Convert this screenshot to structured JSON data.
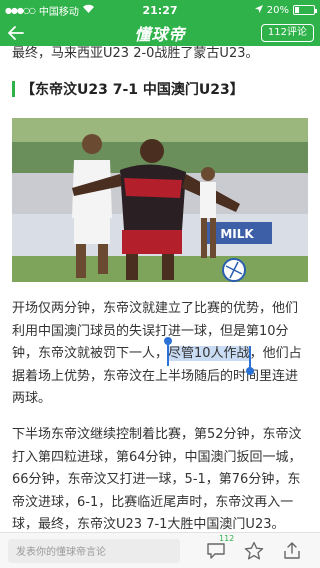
{
  "status_bar": {
    "carrier": "中国移动",
    "time": "21:27",
    "battery_percent": "20%",
    "battery_level": 0.2
  },
  "nav": {
    "title": "懂球帝",
    "comments_button": "112评论"
  },
  "article": {
    "partial_top_line": "最终，马来西亚U23 2-0战胜了蒙古U23。",
    "heading": "【东帝汶U23 7-1 中国澳门U23】",
    "para1_before": "开场仅两分钟，东帝汶就建立了比赛的优势，他们利用中国澳门球员的失误打进一球，但是第10分钟，东帝汶就被罚下一人，",
    "para1_highlight": "尽管10人作战",
    "para1_after": "，他们占据着场上优势，东帝汶在上半场随后的时间里连进两球。",
    "para2": "下半场东帝汶继续控制着比赛，第52分钟，东帝汶打入第四粒进球，第64分钟，中国澳门扳回一城，66分钟，东帝汶又打进一球，5-1，第76分钟，东帝汶进球，6-1，比赛临近尾声时，东帝汶再入一球，最终，东帝汶U23 7-1大胜中国澳门U23。",
    "photo_ad_text": "MILK"
  },
  "bottom_bar": {
    "comment_placeholder": "发表你的懂球帝言论",
    "comment_badge": "112"
  },
  "colors": {
    "brand_green": "#2fb24a",
    "selection_blue": "#2a72d6",
    "selection_bg": "#c9dcf3"
  },
  "icons": [
    "signal-icon",
    "wifi-icon",
    "location-icon",
    "battery-icon",
    "back-arrow-icon",
    "comment-icon",
    "star-icon",
    "share-icon"
  ]
}
